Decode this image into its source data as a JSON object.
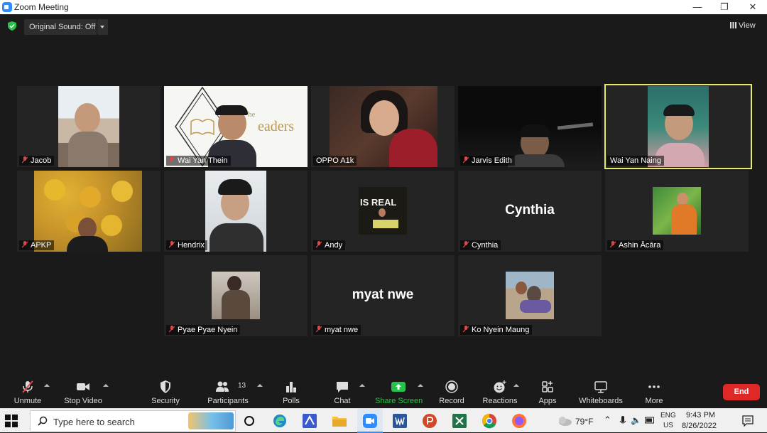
{
  "window": {
    "title": "Zoom Meeting",
    "controls": [
      "—",
      "❐",
      "✕"
    ]
  },
  "top_controls": {
    "original_sound": "Original Sound: Off",
    "view": "View"
  },
  "participants": [
    {
      "name": "Jacob",
      "muted": true
    },
    {
      "name": "Wai Yan Thein",
      "muted": true
    },
    {
      "name": "OPPO A1k",
      "muted": false
    },
    {
      "name": "Jarvis Edith",
      "muted": true
    },
    {
      "name": "Wai Yan Naing",
      "muted": false,
      "active_speaker": true
    },
    {
      "name": "APKP",
      "muted": true
    },
    {
      "name": "Hendrix",
      "muted": true
    },
    {
      "name": "Andy",
      "muted": true
    },
    {
      "name": "Cynthia",
      "muted": true,
      "display_text": "Cynthia"
    },
    {
      "name": "Ashin Ācāra",
      "muted": true
    },
    {
      "name": "Pyae Pyae Nyein",
      "muted": true
    },
    {
      "name": "myat nwe",
      "muted": true,
      "display_text": "myat nwe"
    },
    {
      "name": "Ko Nyein Maung",
      "muted": true
    }
  ],
  "tile_text": {
    "readers_logo": "The Readers",
    "andy_sign": "IS REAL"
  },
  "toolbar": {
    "unmute": "Unmute",
    "stop_video": "Stop Video",
    "security": "Security",
    "participants": "Participants",
    "participants_count": "13",
    "polls": "Polls",
    "chat": "Chat",
    "share_screen": "Share Screen",
    "record": "Record",
    "reactions": "Reactions",
    "apps": "Apps",
    "whiteboards": "Whiteboards",
    "more": "More",
    "end": "End"
  },
  "taskbar": {
    "search_placeholder": "Type here to search",
    "weather": "79°F",
    "lang": "ENG",
    "region": "US",
    "time": "9:43 PM",
    "date": "8/26/2022"
  },
  "colors": {
    "accent": "#2d8cff",
    "end": "#e02828",
    "share": "#27c24c",
    "speaker_outline": "#e5e96b",
    "muted_mic": "#e04848"
  }
}
